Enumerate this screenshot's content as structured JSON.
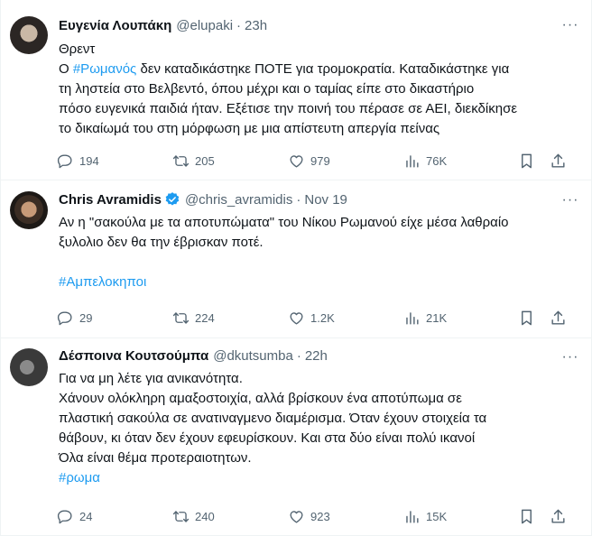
{
  "tweets": [
    {
      "name": "Ευγενία Λουπάκη",
      "handle": "@elupaki",
      "dot": "·",
      "time": "23h",
      "lines": [
        [
          "Θρεντ"
        ],
        [
          "Ο ",
          "#Ρωμανός",
          " δεν καταδικάστηκε ΠΟΤΕ για τρομοκρατία. Καταδικάστηκε για"
        ],
        [
          "τη ληστεία στο Βελβεντό, όπου μέχρι και ο ταμίας  είπε στο δικαστήριο"
        ],
        [
          "πόσο ευγενικά παιδιά ήταν. Εξέτισε την ποινή του πέρασε σε ΑΕΙ, διεκδίκησε"
        ],
        [
          "το δικαίωμά του στη μόρφωση με μια απίστευτη απεργία πείνας"
        ]
      ],
      "stats": {
        "replies": "194",
        "retweets": "205",
        "likes": "979",
        "views": "76K"
      }
    },
    {
      "name": "Chris Avramidis",
      "verified": true,
      "handle": "@chris_avramidis",
      "dot": "·",
      "time": "Nov 19",
      "line1": "Αν η \"σακούλα με τα αποτυπώματα\" του Νίκου Ρωμανού είχε μέσα λαθραίο",
      "line2": "ξυλολιο δεν θα την έβρισκαν ποτέ.",
      "hashtag": "#Αμπελοκηποι",
      "stats": {
        "replies": "29",
        "retweets": "224",
        "likes": "1.2K",
        "views": "21K"
      }
    },
    {
      "name": "Δέσποινα Κουτσούμπα",
      "handle": "@dkutsumba",
      "dot": "·",
      "time": "22h",
      "line1": "Για να μη λέτε για ανικανότητα.",
      "line2": "Χάνουν ολόκληρη αμαξοστοιχία, αλλά βρίσκουν ένα αποτύπωμα σε",
      "line3": "πλαστική σακούλα σε ανατιναγμενο διαμέρισμα. Όταν έχουν στοιχεία τα",
      "line4": "θάβουν, κι όταν δεν έχουν εφευρίσκουν. Και στα δύο είναι πολύ ικανοί",
      "line5": "Όλα είναι θέμα προτεραιοτητων.",
      "hashtag": "#ρωμα",
      "stats": {
        "replies": "24",
        "retweets": "240",
        "likes": "923",
        "views": "15K"
      }
    }
  ],
  "more_glyph": "···",
  "colors": {
    "link": "#1d9bf0",
    "muted": "#536471",
    "text": "#0f1419",
    "verified": "#1d9bf0"
  },
  "icons": [
    "reply-icon",
    "retweet-icon",
    "like-icon",
    "views-icon",
    "bookmark-icon",
    "share-icon",
    "verified-badge-icon",
    "more-icon"
  ]
}
